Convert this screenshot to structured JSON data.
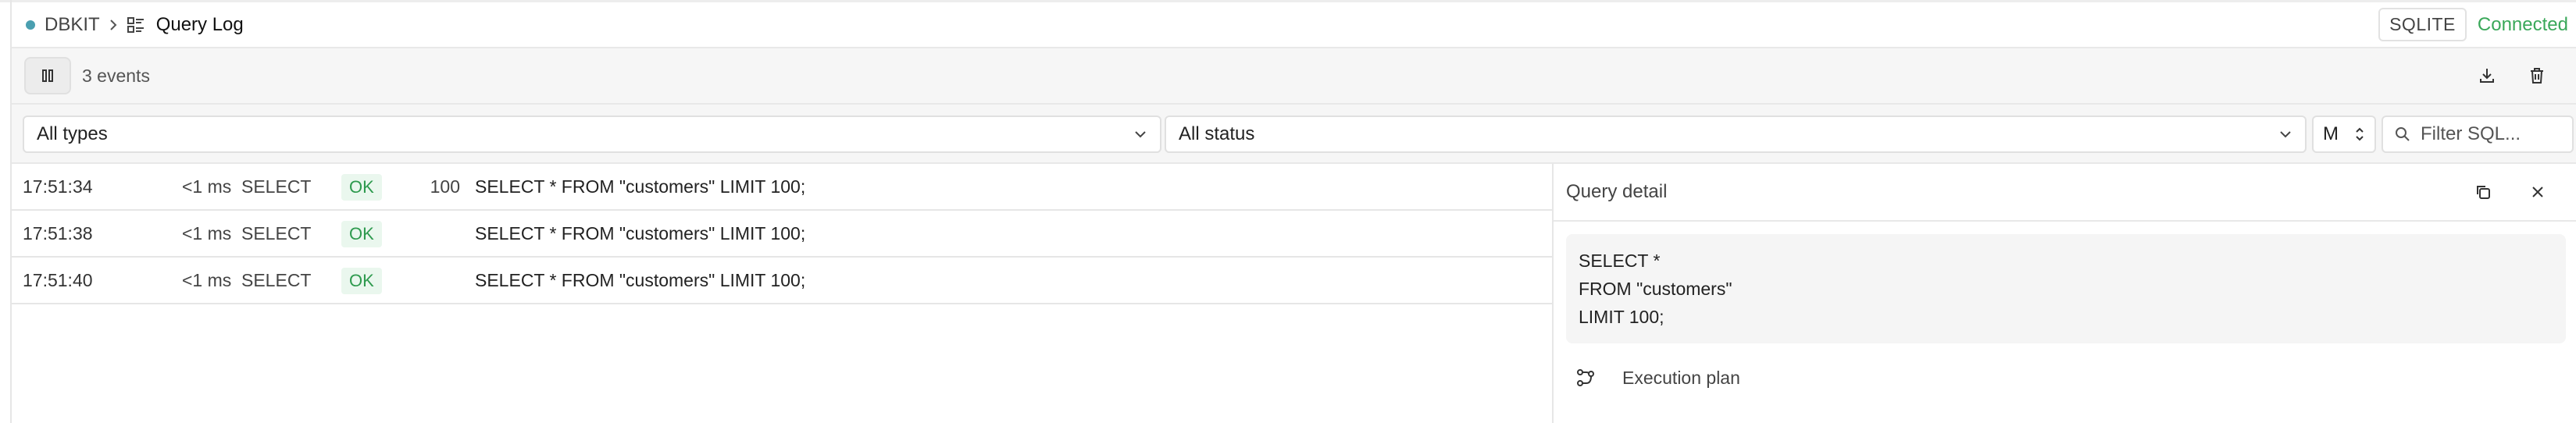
{
  "header": {
    "app_name": "DBKIT",
    "page_title": "Query Log",
    "db_badge": "SQLITE",
    "connection_status": "Connected",
    "status_color": "#3aa85a",
    "dot_color": "#4a9fb0"
  },
  "toolbar": {
    "events_count": "3 events",
    "pause_icon": "pause-icon",
    "download_icon": "download-icon",
    "trash_icon": "trash-icon"
  },
  "filters": {
    "type_selected": "All types",
    "status_selected": "All status",
    "ms_selected": "M",
    "sql_placeholder": "Filter SQL..."
  },
  "table": {
    "rows": [
      {
        "time": "17:51:34",
        "duration": "<1 ms",
        "type": "SELECT",
        "status": "OK",
        "rows": "100",
        "sql": "SELECT * FROM \"customers\" LIMIT 100;"
      },
      {
        "time": "17:51:38",
        "duration": "<1 ms",
        "type": "SELECT",
        "status": "OK",
        "rows": "",
        "sql": "SELECT * FROM \"customers\" LIMIT 100;"
      },
      {
        "time": "17:51:40",
        "duration": "<1 ms",
        "type": "SELECT",
        "status": "OK",
        "rows": "",
        "sql": "SELECT * FROM \"customers\" LIMIT 100;"
      }
    ]
  },
  "detail": {
    "title": "Query detail",
    "sql_lines": [
      "SELECT *",
      "FROM \"customers\"",
      "LIMIT 100;"
    ],
    "execution_plan_label": "Execution plan"
  }
}
